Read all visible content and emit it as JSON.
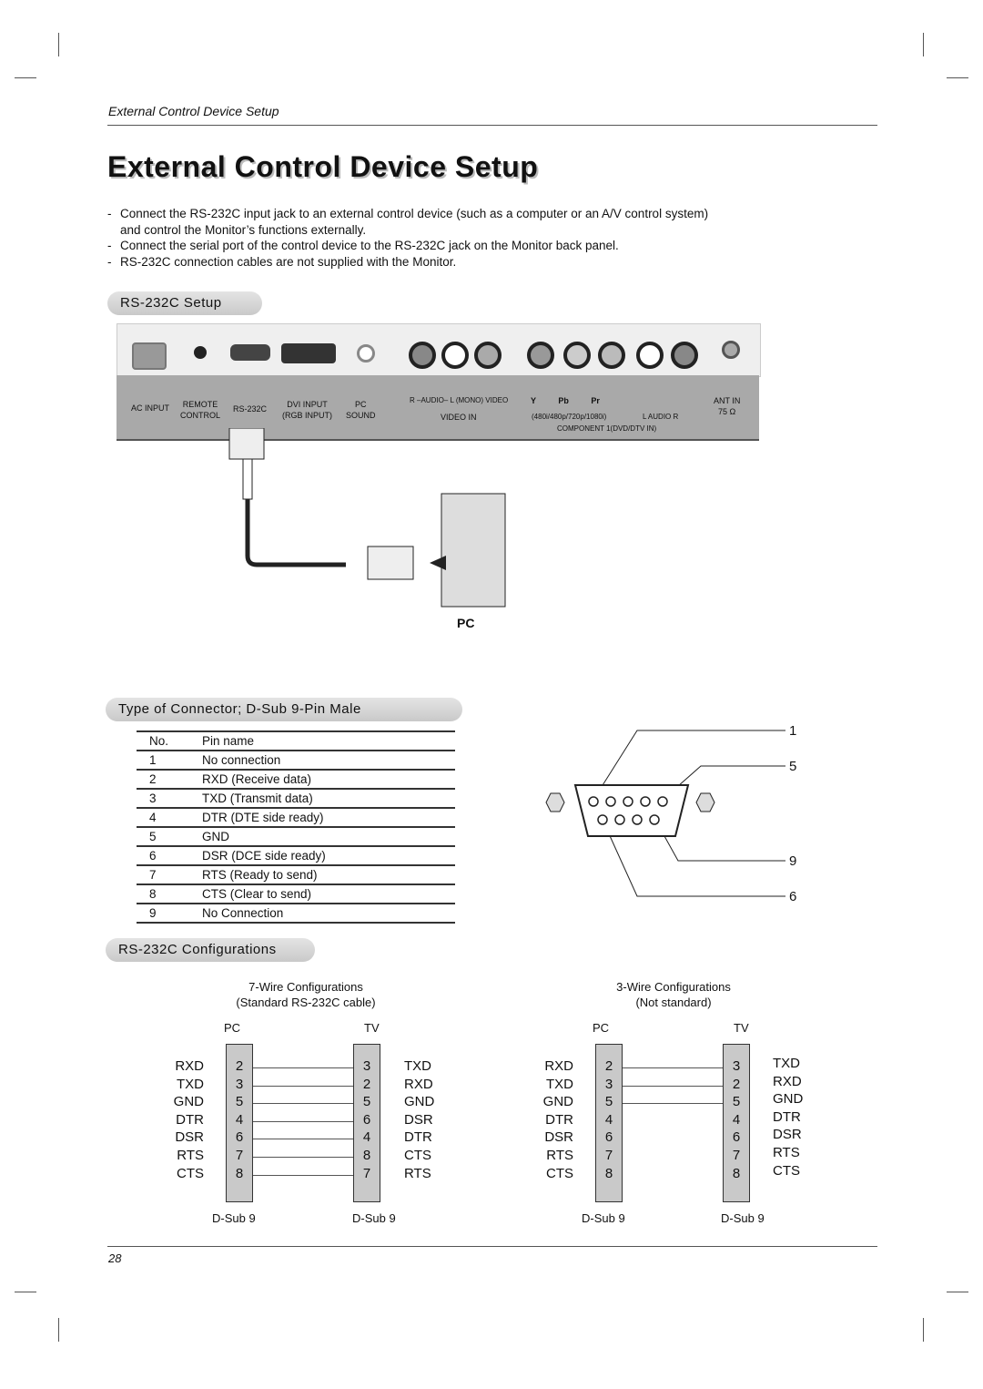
{
  "running_head": "External Control Device Setup",
  "page_title": "External Control Device Setup",
  "bullets": [
    {
      "line1": "Connect the RS-232C input jack to an external control device (such as a computer or an A/V control system)",
      "line2": "and control the Monitor’s functions externally."
    },
    {
      "line1": "Connect the serial port of the control device to the RS-232C jack on the Monitor back panel."
    },
    {
      "line1": "RS-232C connection cables are not supplied with the Monitor."
    }
  ],
  "bullet_marker": "-",
  "sections": {
    "setup": "RS-232C Setup",
    "connector": "Type of Connector; D-Sub 9-Pin Male",
    "configs": "RS-232C Configurations"
  },
  "back_panel": {
    "ac_input": "AC INPUT",
    "remote_1": "REMOTE",
    "remote_2": "CONTROL",
    "rs232c": "RS-232C",
    "dvi_1": "DVI INPUT",
    "dvi_2": "(RGB INPUT)",
    "pc_1": "PC",
    "pc_2": "SOUND",
    "video_in_audio": "R –AUDIO– L (MONO) VIDEO",
    "video_in": "VIDEO IN",
    "component_jacks": "Y   Pb   Pr",
    "component_res": "(480i/480p/720p/1080i)",
    "component_audio": "L  AUDIO  R",
    "component_label": "COMPONENT 1(DVD/DTV IN)",
    "ant_1": "ANT IN",
    "ant_2": "75 Ω"
  },
  "pc_label": "PC",
  "pin_table": {
    "headers": [
      "No.",
      "Pin name"
    ],
    "rows": [
      [
        "1",
        "No connection"
      ],
      [
        "2",
        "RXD (Receive data)"
      ],
      [
        "3",
        "TXD (Transmit data)"
      ],
      [
        "4",
        "DTR (DTE side ready)"
      ],
      [
        "5",
        "GND"
      ],
      [
        "6",
        "DSR (DCE side ready)"
      ],
      [
        "7",
        "RTS (Ready to send)"
      ],
      [
        "8",
        "CTS (Clear to send)"
      ],
      [
        "9",
        "No Connection"
      ]
    ]
  },
  "connector_callouts": [
    "1",
    "5",
    "9",
    "6"
  ],
  "configurations": [
    {
      "title1": "7-Wire Configurations",
      "title2": "(Standard RS-232C cable)",
      "left_head": "PC",
      "right_head": "TV",
      "left_signals": [
        "RXD",
        "TXD",
        "GND",
        "DTR",
        "DSR",
        "RTS",
        "CTS"
      ],
      "left_pins": [
        "2",
        "3",
        "5",
        "4",
        "6",
        "7",
        "8"
      ],
      "right_pins": [
        "3",
        "2",
        "5",
        "6",
        "4",
        "8",
        "7"
      ],
      "right_signals": [
        "TXD",
        "RXD",
        "GND",
        "DSR",
        "DTR",
        "CTS",
        "RTS"
      ],
      "wired_rows": 7,
      "left_foot": "D-Sub 9",
      "right_foot": "D-Sub 9"
    },
    {
      "title1": "3-Wire Configurations",
      "title2": "(Not standard)",
      "left_head": "PC",
      "right_head": "TV",
      "left_signals": [
        "RXD",
        "TXD",
        "GND",
        "DTR",
        "DSR",
        "RTS",
        "CTS"
      ],
      "left_pins": [
        "2",
        "3",
        "5",
        "4",
        "6",
        "7",
        "8"
      ],
      "right_pins": [
        "3",
        "2",
        "5",
        "4",
        "6",
        "7",
        "8"
      ],
      "right_signals": [
        "TXD",
        "RXD",
        "GND",
        "DTR",
        "DSR",
        "RTS",
        "CTS"
      ],
      "wired_rows": 3,
      "left_foot": "D-Sub 9",
      "right_foot": "D-Sub 9"
    }
  ],
  "page_number": "28"
}
